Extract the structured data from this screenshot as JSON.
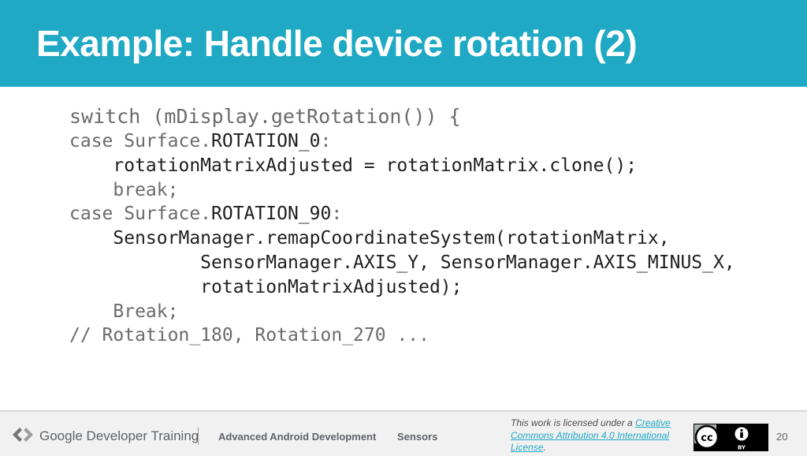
{
  "slide": {
    "title": "Example: Handle device rotation (2)",
    "number": "20"
  },
  "code": {
    "lines": [
      {
        "parts": [
          "switch (mDisplay.getRotation()) {"
        ]
      },
      {
        "parts": [
          "case Surface.",
          "ROTATION_0",
          ":"
        ]
      },
      {
        "parts": [
          "    rotationMatrixAdjusted = rotationMatrix.clone();"
        ]
      },
      {
        "parts": [
          "    break;"
        ]
      },
      {
        "parts": [
          "case Surface.",
          "ROTATION_90",
          ":"
        ]
      },
      {
        "parts": [
          "    SensorManager.remapCoordinateSystem(rotationMatrix,"
        ]
      },
      {
        "parts": [
          "            SensorManager.AXIS_Y, SensorManager.AXIS_MINUS_X,"
        ]
      },
      {
        "parts": [
          "            rotationMatrixAdjusted);"
        ]
      },
      {
        "parts": [
          "    Break;"
        ]
      },
      {
        "parts": [
          "// Rotation_180, Rotation_270 ..."
        ]
      }
    ]
  },
  "footer": {
    "brand": "Google Developer Training",
    "course": "Advanced Android Development",
    "topic": "Sensors",
    "license_prefix": "This work is licensed under a ",
    "license_link": "Creative Commons Attribution 4.0 International License",
    "license_suffix": ".",
    "badge_by": "BY"
  },
  "colors": {
    "header": "#1fa9c4",
    "link": "#1fa9c4"
  }
}
